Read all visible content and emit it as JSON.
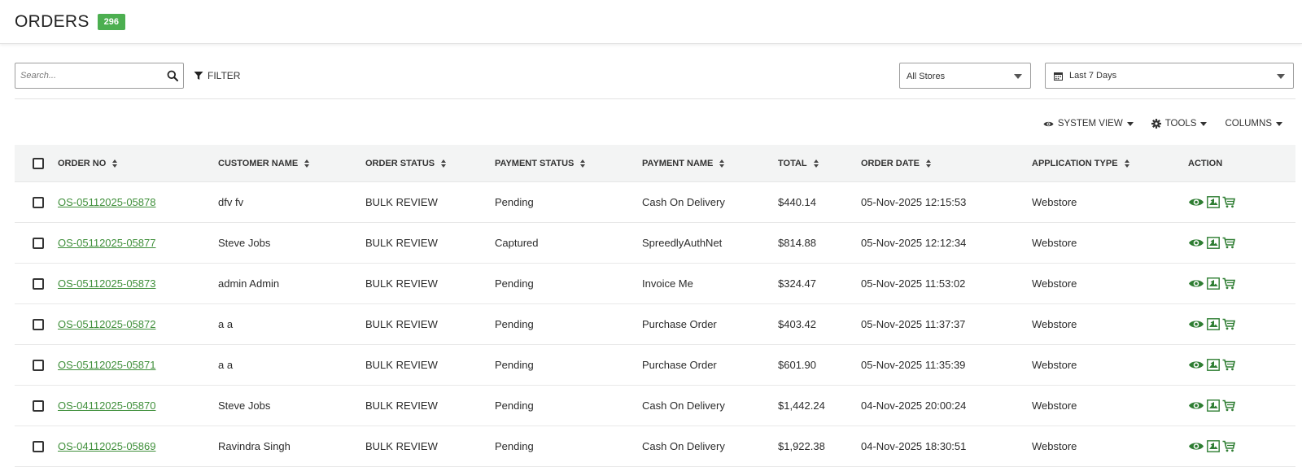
{
  "header": {
    "title": "ORDERS",
    "count": "296"
  },
  "colors": {
    "accent": "#4caf50",
    "link": "#3f8f3a",
    "action": "#2e7d32"
  },
  "search": {
    "placeholder": "Search..."
  },
  "filter": {
    "label": "FILTER"
  },
  "store_select": {
    "value": "All Stores"
  },
  "date_select": {
    "value": "Last 7 Days"
  },
  "toolbar": {
    "system_view": "SYSTEM VIEW",
    "tools": "TOOLS",
    "columns": "COLUMNS"
  },
  "table": {
    "headers": [
      "ORDER NO",
      "CUSTOMER NAME",
      "ORDER STATUS",
      "PAYMENT STATUS",
      "PAYMENT NAME",
      "TOTAL",
      "ORDER DATE",
      "APPLICATION TYPE",
      "ACTION"
    ],
    "rows": [
      {
        "order_no": "OS-05112025-05878",
        "customer": "dfv fv",
        "order_status": "BULK REVIEW",
        "payment_status": "Pending",
        "payment_name": "Cash On Delivery",
        "total": "$440.14",
        "date": "05-Nov-2025 12:15:53",
        "app_type": "Webstore"
      },
      {
        "order_no": "OS-05112025-05877",
        "customer": "Steve Jobs",
        "order_status": "BULK REVIEW",
        "payment_status": "Captured",
        "payment_name": "SpreedlyAuthNet",
        "total": "$814.88",
        "date": "05-Nov-2025 12:12:34",
        "app_type": "Webstore"
      },
      {
        "order_no": "OS-05112025-05873",
        "customer": "admin Admin",
        "order_status": "BULK REVIEW",
        "payment_status": "Pending",
        "payment_name": "Invoice Me",
        "total": "$324.47",
        "date": "05-Nov-2025 11:53:02",
        "app_type": "Webstore"
      },
      {
        "order_no": "OS-05112025-05872",
        "customer": "a a",
        "order_status": "BULK REVIEW",
        "payment_status": "Pending",
        "payment_name": "Purchase Order",
        "total": "$403.42",
        "date": "05-Nov-2025 11:37:37",
        "app_type": "Webstore"
      },
      {
        "order_no": "OS-05112025-05871",
        "customer": "a a",
        "order_status": "BULK REVIEW",
        "payment_status": "Pending",
        "payment_name": "Purchase Order",
        "total": "$601.90",
        "date": "05-Nov-2025 11:35:39",
        "app_type": "Webstore"
      },
      {
        "order_no": "OS-04112025-05870",
        "customer": "Steve Jobs",
        "order_status": "BULK REVIEW",
        "payment_status": "Pending",
        "payment_name": "Cash On Delivery",
        "total": "$1,442.24",
        "date": "04-Nov-2025 20:00:24",
        "app_type": "Webstore"
      },
      {
        "order_no": "OS-04112025-05869",
        "customer": "Ravindra Singh",
        "order_status": "BULK REVIEW",
        "payment_status": "Pending",
        "payment_name": "Cash On Delivery",
        "total": "$1,922.38",
        "date": "04-Nov-2025 18:30:51",
        "app_type": "Webstore"
      }
    ]
  }
}
